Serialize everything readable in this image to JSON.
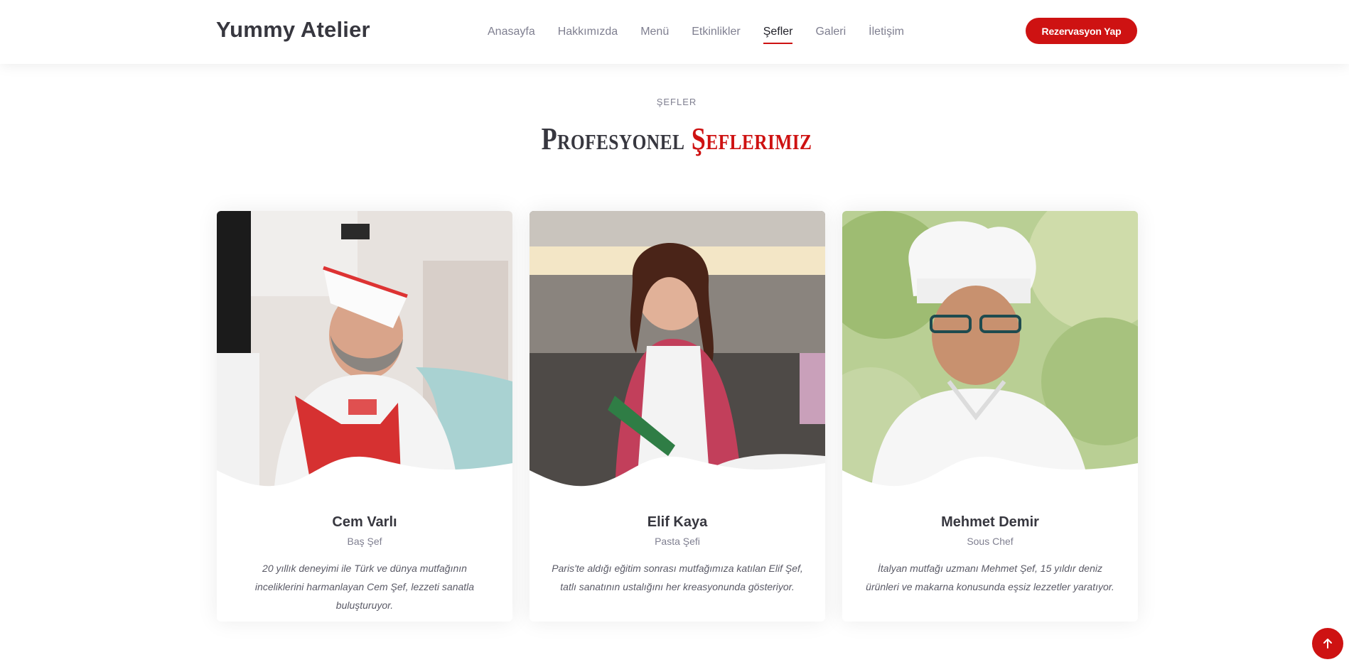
{
  "header": {
    "logo": "Yummy Atelier",
    "nav": [
      "Anasayfa",
      "Hakkımızda",
      "Menü",
      "Etkinlikler",
      "Şefler",
      "Galeri",
      "İletişim"
    ],
    "active_nav": "Şefler",
    "cta_label": "Rezervasyon Yap"
  },
  "section": {
    "label": "ŞEFLER",
    "title_main": "Profesyonel ",
    "title_accent": "Şeflerimiz"
  },
  "chefs": [
    {
      "name": "Cem Varlı",
      "role": "Baş Şef",
      "bio": "20 yıllık deneyimi ile Türk ve dünya mutfağının inceliklerini harmanlayan Cem Şef, lezzeti sanatla buluşturuyor."
    },
    {
      "name": "Elif Kaya",
      "role": "Pasta Şefi",
      "bio": "Paris'te aldığı eğitim sonrası mutfağımıza katılan Elif Şef, tatlı sanatının ustalığını her kreasyonunda gösteriyor."
    },
    {
      "name": "Mehmet Demir",
      "role": "Sous Chef",
      "bio": "İtalyan mutfağı uzmanı Mehmet Şef, 15 yıldır deniz ürünleri ve makarna konusunda eşsiz lezzetler yaratıyor."
    }
  ],
  "icons": {
    "back_to_top": "arrow-up-icon"
  },
  "colors": {
    "accent": "#ce1212",
    "heading": "#37373f",
    "muted": "#7f7f90"
  }
}
